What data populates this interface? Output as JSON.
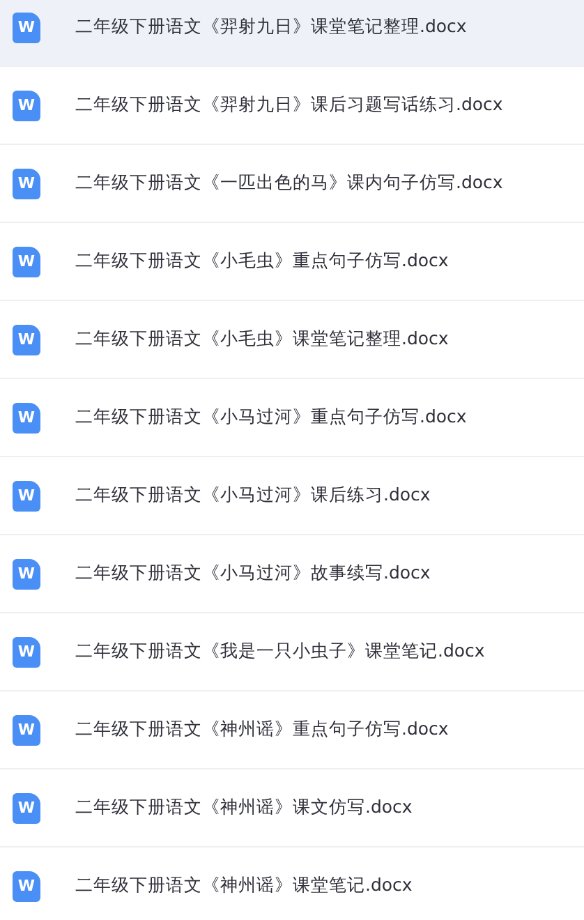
{
  "files": [
    {
      "name": "二年级下册语文《羿射九日》课堂笔记整理.docx",
      "icon_letter": "W",
      "selected": true
    },
    {
      "name": "二年级下册语文《羿射九日》课后习题写话练习.docx",
      "icon_letter": "W",
      "selected": false
    },
    {
      "name": "二年级下册语文《一匹出色的马》课内句子仿写.docx",
      "icon_letter": "W",
      "selected": false
    },
    {
      "name": "二年级下册语文《小毛虫》重点句子仿写.docx",
      "icon_letter": "W",
      "selected": false
    },
    {
      "name": "二年级下册语文《小毛虫》课堂笔记整理.docx",
      "icon_letter": "W",
      "selected": false
    },
    {
      "name": "二年级下册语文《小马过河》重点句子仿写.docx",
      "icon_letter": "W",
      "selected": false
    },
    {
      "name": "二年级下册语文《小马过河》课后练习.docx",
      "icon_letter": "W",
      "selected": false
    },
    {
      "name": "二年级下册语文《小马过河》故事续写.docx",
      "icon_letter": "W",
      "selected": false
    },
    {
      "name": "二年级下册语文《我是一只小虫子》课堂笔记.docx",
      "icon_letter": "W",
      "selected": false
    },
    {
      "name": "二年级下册语文《神州谣》重点句子仿写.docx",
      "icon_letter": "W",
      "selected": false
    },
    {
      "name": "二年级下册语文《神州谣》课文仿写.docx",
      "icon_letter": "W",
      "selected": false
    },
    {
      "name": "二年级下册语文《神州谣》课堂笔记.docx",
      "icon_letter": "W",
      "selected": false
    }
  ]
}
